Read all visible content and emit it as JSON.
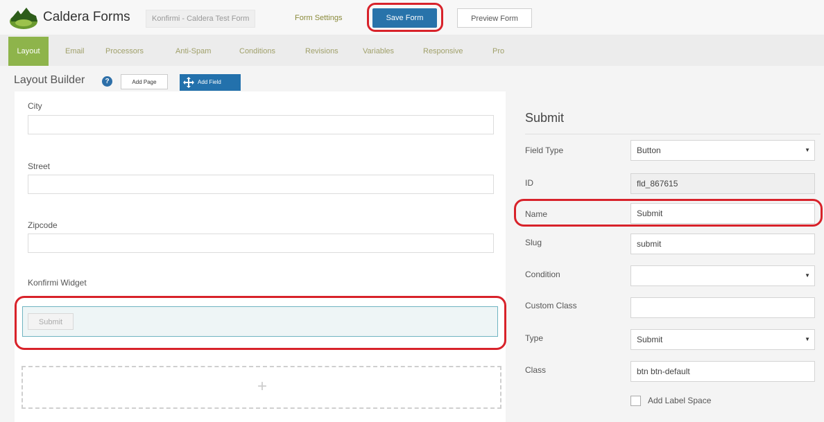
{
  "app": {
    "name": "Caldera Forms",
    "form_name": "Konfirmi - Caldera Test Form",
    "form_settings": "Form Settings",
    "save": "Save Form",
    "preview": "Preview Form"
  },
  "nav": {
    "tabs": [
      "Layout",
      "Email",
      "Processors",
      "Anti-Spam",
      "Conditions",
      "Revisions",
      "Variables",
      "Responsive",
      "Pro"
    ],
    "active": "Layout"
  },
  "builder": {
    "title": "Layout Builder",
    "help": "?",
    "add_page": "Add Page",
    "add_field": "Add Field"
  },
  "left": {
    "fields": [
      {
        "label": "City"
      },
      {
        "label": "Street"
      },
      {
        "label": "Zipcode"
      }
    ],
    "widget_label": "Konfirmi Widget",
    "widget_button": "Submit",
    "add_zone_symbol": "+"
  },
  "right": {
    "title": "Submit",
    "field_type_label": "Field Type",
    "field_type_value": "Button",
    "id_label": "ID",
    "id_value": "fld_867615",
    "name_label": "Name",
    "name_value": "Submit",
    "slug_label": "Slug",
    "slug_value": "submit",
    "condition_label": "Condition",
    "condition_value": "",
    "custom_class_label": "Custom Class",
    "custom_class_value": "",
    "type_label": "Type",
    "type_value": "Submit",
    "class_label": "Class",
    "class_value": "btn btn-default",
    "label_space": "Add Label Space"
  },
  "colors": {
    "accent_green": "#8eb44b",
    "primary_blue": "#2873aa",
    "highlight_red": "#d8222a"
  }
}
